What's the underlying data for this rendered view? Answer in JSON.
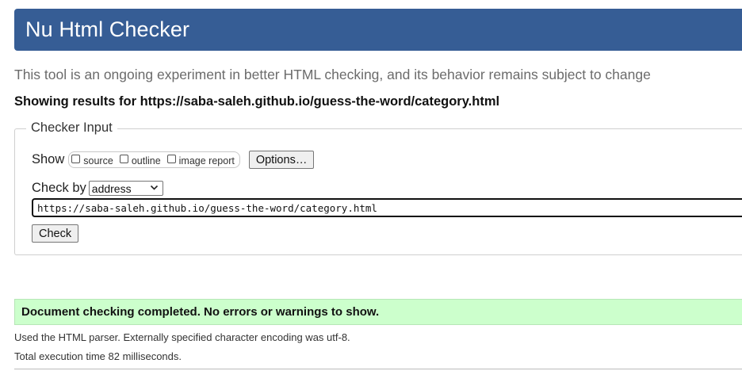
{
  "header": {
    "title": "Nu Html Checker"
  },
  "tagline": "This tool is an ongoing experiment in better HTML checking, and its behavior remains subject to change",
  "results_heading": "Showing results for https://saba-saleh.github.io/guess-the-word/category.html",
  "checker": {
    "legend": "Checker Input",
    "show_label": "Show",
    "show_options": [
      {
        "label": "source",
        "checked": false
      },
      {
        "label": "outline",
        "checked": false
      },
      {
        "label": "image report",
        "checked": false
      }
    ],
    "options_button": "Options…",
    "check_by_label": "Check by",
    "check_by_value": "address",
    "url_value": "https://saba-saleh.github.io/guess-the-word/category.html",
    "check_button": "Check"
  },
  "result": {
    "message": "Document checking completed. No errors or warnings to show.",
    "parser_info": "Used the HTML parser. Externally specified character encoding was utf-8.",
    "execution_time": "Total execution time 82 milliseconds."
  },
  "colors": {
    "banner": "#365d95",
    "success_bg": "#ccffcc"
  },
  "icons": {
    "select_arrow": "chevron-down-icon"
  }
}
